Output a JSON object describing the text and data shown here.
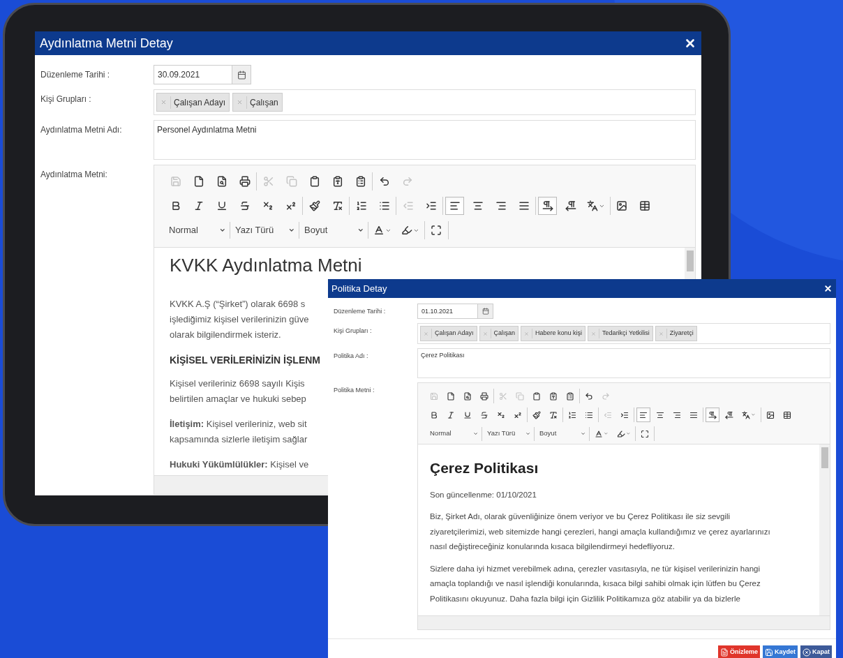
{
  "dialogs": [
    {
      "title": "Aydınlatma Metni Detay",
      "fields": [
        {
          "kind": "date",
          "label": "Düzenleme Tarihi :",
          "value": "30.09.2021"
        },
        {
          "kind": "tags",
          "label": "Kişi Grupları :",
          "tags": [
            "Çalışan Adayı",
            "Çalışan"
          ]
        },
        {
          "kind": "textarea",
          "label": "Aydınlatma Metni Adı:",
          "value": "Personel Aydınlatma Metni"
        },
        {
          "kind": "editor",
          "label": "Aydınlatma Metni:",
          "toolbar": [
            [
              [
                {
                  "kind": "save",
                  "pressed": false,
                  "disabled": true
                },
                {
                  "kind": "new",
                  "pressed": false,
                  "disabled": false
                },
                {
                  "kind": "preview",
                  "pressed": false,
                  "disabled": false
                },
                {
                  "kind": "print",
                  "pressed": false,
                  "disabled": false
                }
              ],
              [
                {
                  "kind": "cut",
                  "pressed": false,
                  "disabled": true
                },
                {
                  "kind": "copy",
                  "pressed": false,
                  "disabled": true
                },
                {
                  "kind": "paste",
                  "pressed": false,
                  "disabled": false
                },
                {
                  "kind": "paste-text",
                  "pressed": false,
                  "disabled": false
                },
                {
                  "kind": "paste-word",
                  "pressed": false,
                  "disabled": false
                }
              ],
              [
                {
                  "kind": "undo",
                  "pressed": false,
                  "disabled": false
                },
                {
                  "kind": "redo",
                  "pressed": false,
                  "disabled": true
                }
              ]
            ],
            [
              [
                {
                  "kind": "bold",
                  "pressed": false,
                  "disabled": false
                },
                {
                  "kind": "italic",
                  "pressed": false,
                  "disabled": false
                },
                {
                  "kind": "underline",
                  "pressed": false,
                  "disabled": false
                },
                {
                  "kind": "strike",
                  "pressed": false,
                  "disabled": false
                },
                {
                  "kind": "subscript",
                  "pressed": false,
                  "disabled": false
                },
                {
                  "kind": "superscript",
                  "pressed": false,
                  "disabled": false
                }
              ],
              [
                {
                  "kind": "painter",
                  "pressed": false,
                  "disabled": false
                },
                {
                  "kind": "remove-format",
                  "pressed": false,
                  "disabled": false
                }
              ],
              [
                {
                  "kind": "ordered-list",
                  "pressed": false,
                  "disabled": false
                },
                {
                  "kind": "bullet-list",
                  "pressed": false,
                  "disabled": false
                }
              ],
              [
                {
                  "kind": "outdent",
                  "pressed": false,
                  "disabled": true
                },
                {
                  "kind": "indent",
                  "pressed": false,
                  "disabled": false
                }
              ],
              [
                {
                  "kind": "align-left",
                  "pressed": true,
                  "disabled": false
                },
                {
                  "kind": "align-center",
                  "pressed": false,
                  "disabled": false
                },
                {
                  "kind": "align-right",
                  "pressed": false,
                  "disabled": false
                },
                {
                  "kind": "justify",
                  "pressed": false,
                  "disabled": false
                }
              ],
              [
                {
                  "kind": "ltr",
                  "pressed": true,
                  "disabled": false
                },
                {
                  "kind": "rtl",
                  "pressed": false,
                  "disabled": false
                },
                {
                  "kind": "language",
                  "pressed": false,
                  "disabled": false
                }
              ],
              [
                {
                  "kind": "image",
                  "pressed": false,
                  "disabled": false
                },
                {
                  "kind": "table",
                  "pressed": false,
                  "disabled": false
                }
              ]
            ],
            [
              [
                {
                  "kind": "combo",
                  "label": "Normal"
                }
              ],
              [
                {
                  "kind": "combo",
                  "label": "Yazı Türü"
                }
              ],
              [
                {
                  "kind": "combo",
                  "label": "Boyut"
                }
              ],
              [
                {
                  "kind": "text-color",
                  "pressed": false,
                  "disabled": false
                },
                {
                  "kind": "bg-color",
                  "pressed": false,
                  "disabled": false
                }
              ],
              [
                {
                  "kind": "maximize",
                  "pressed": false,
                  "disabled": false
                }
              ]
            ]
          ],
          "content": [
            {
              "kind": "heading",
              "lines": [
                "KVKK Aydınlatma Metni"
              ]
            },
            {
              "kind": "paragraph",
              "lines": [
                "KVKK A.Ş (“Şirket”) olarak 6698 s",
                "işlediğimiz kişisel verilerinizin güve",
                "olarak bilgilendirmek isteriz."
              ]
            },
            {
              "kind": "subheading",
              "lines": [
                "KİŞİSEL VERİLERİNİZİN İŞLENM"
              ]
            },
            {
              "kind": "paragraph",
              "lines": [
                "Kişisel verileriniz 6698 sayılı Kişis",
                "belirtilen amaçlar ve hukuki sebep"
              ]
            },
            {
              "kind": "paragraph",
              "lines": [
                "**İletişim:** Kişisel verileriniz, web sit",
                "kapsamında sizlerle iletişim sağlar"
              ]
            },
            {
              "kind": "paragraph",
              "lines": [
                "**Hukuki Yükümlülükler:** Kişisel ve"
              ]
            }
          ]
        }
      ]
    },
    {
      "title": "Politika Detay",
      "fields": [
        {
          "kind": "date",
          "label": "Düzenleme Tarihi :",
          "value": "01.10.2021"
        },
        {
          "kind": "tags",
          "label": "Kişi Grupları :",
          "tags": [
            "Çalışan Adayı",
            "Çalışan",
            "Habere konu kişi",
            "Tedarikçi Yetkilisi",
            "Ziyaretçi"
          ]
        },
        {
          "kind": "textarea",
          "label": "Politika Adı :",
          "value": "Çerez Politikası"
        },
        {
          "kind": "editor",
          "label": "Politika Metni :",
          "toolbar": [
            [
              [
                {
                  "kind": "save",
                  "pressed": false,
                  "disabled": true
                },
                {
                  "kind": "new",
                  "pressed": false,
                  "disabled": false
                },
                {
                  "kind": "preview",
                  "pressed": false,
                  "disabled": false
                },
                {
                  "kind": "print",
                  "pressed": false,
                  "disabled": false
                }
              ],
              [
                {
                  "kind": "cut",
                  "pressed": false,
                  "disabled": true
                },
                {
                  "kind": "copy",
                  "pressed": false,
                  "disabled": true
                },
                {
                  "kind": "paste",
                  "pressed": false,
                  "disabled": false
                },
                {
                  "kind": "paste-text",
                  "pressed": false,
                  "disabled": false
                },
                {
                  "kind": "paste-word",
                  "pressed": false,
                  "disabled": false
                }
              ],
              [
                {
                  "kind": "undo",
                  "pressed": false,
                  "disabled": false
                },
                {
                  "kind": "redo",
                  "pressed": false,
                  "disabled": true
                }
              ]
            ],
            [
              [
                {
                  "kind": "bold",
                  "pressed": false,
                  "disabled": false
                },
                {
                  "kind": "italic",
                  "pressed": false,
                  "disabled": false
                },
                {
                  "kind": "underline",
                  "pressed": false,
                  "disabled": false
                },
                {
                  "kind": "strike",
                  "pressed": false,
                  "disabled": false
                },
                {
                  "kind": "subscript",
                  "pressed": false,
                  "disabled": false
                },
                {
                  "kind": "superscript",
                  "pressed": false,
                  "disabled": false
                }
              ],
              [
                {
                  "kind": "painter",
                  "pressed": false,
                  "disabled": false
                },
                {
                  "kind": "remove-format",
                  "pressed": false,
                  "disabled": false
                }
              ],
              [
                {
                  "kind": "ordered-list",
                  "pressed": false,
                  "disabled": false
                },
                {
                  "kind": "bullet-list",
                  "pressed": false,
                  "disabled": false
                }
              ],
              [
                {
                  "kind": "outdent",
                  "pressed": false,
                  "disabled": true
                },
                {
                  "kind": "indent",
                  "pressed": false,
                  "disabled": false
                }
              ],
              [
                {
                  "kind": "align-left",
                  "pressed": true,
                  "disabled": false
                },
                {
                  "kind": "align-center",
                  "pressed": false,
                  "disabled": false
                },
                {
                  "kind": "align-right",
                  "pressed": false,
                  "disabled": false
                },
                {
                  "kind": "justify",
                  "pressed": false,
                  "disabled": false
                }
              ],
              [
                {
                  "kind": "ltr",
                  "pressed": true,
                  "disabled": false
                },
                {
                  "kind": "rtl",
                  "pressed": false,
                  "disabled": false
                },
                {
                  "kind": "language",
                  "pressed": false,
                  "disabled": false
                }
              ],
              [
                {
                  "kind": "image",
                  "pressed": false,
                  "disabled": false
                },
                {
                  "kind": "table",
                  "pressed": false,
                  "disabled": false
                }
              ]
            ],
            [
              [
                {
                  "kind": "combo",
                  "label": "Normal"
                }
              ],
              [
                {
                  "kind": "combo",
                  "label": "Yazı Türü"
                }
              ],
              [
                {
                  "kind": "combo",
                  "label": "Boyut"
                }
              ],
              [
                {
                  "kind": "text-color",
                  "pressed": false,
                  "disabled": false
                },
                {
                  "kind": "bg-color",
                  "pressed": false,
                  "disabled": false
                }
              ],
              [
                {
                  "kind": "maximize",
                  "pressed": false,
                  "disabled": false
                }
              ]
            ]
          ],
          "content": [
            {
              "kind": "heading",
              "lines": [
                "Çerez Politikası"
              ]
            },
            {
              "kind": "paragraph",
              "lines": [
                "Son güncellenme: 01/10/2021"
              ]
            },
            {
              "kind": "paragraph",
              "lines": [
                "Biz, Şirket Adı, olarak güvenliğinize önem veriyor ve bu Çerez Politikası ile siz sevgili",
                "ziyaretçilerimizi, web sitemizde hangi çerezleri, hangi amaçla kullandığımız ve çerez ayarlarınızı",
                "nasıl değiştireceğiniz konularında kısaca bilgilendirmeyi hedefliyoruz."
              ]
            },
            {
              "kind": "paragraph",
              "lines": [
                "Sizlere daha iyi hizmet verebilmek adına, çerezler vasıtasıyla, ne tür kişisel verilerinizin hangi",
                "amaçla toplandığı ve nasıl işlendiği konularında, kısaca bilgi sahibi olmak için lütfen bu Çerez",
                "Politikasını okuyunuz. Daha fazla bilgi için Gizlilik Politikamıza göz atabilir ya da bizlerle"
              ]
            }
          ]
        }
      ],
      "buttons": [
        {
          "kind": "preview",
          "label": "Önizleme"
        },
        {
          "kind": "save",
          "label": "Kaydet"
        },
        {
          "kind": "close",
          "label": "Kapat"
        }
      ]
    }
  ]
}
